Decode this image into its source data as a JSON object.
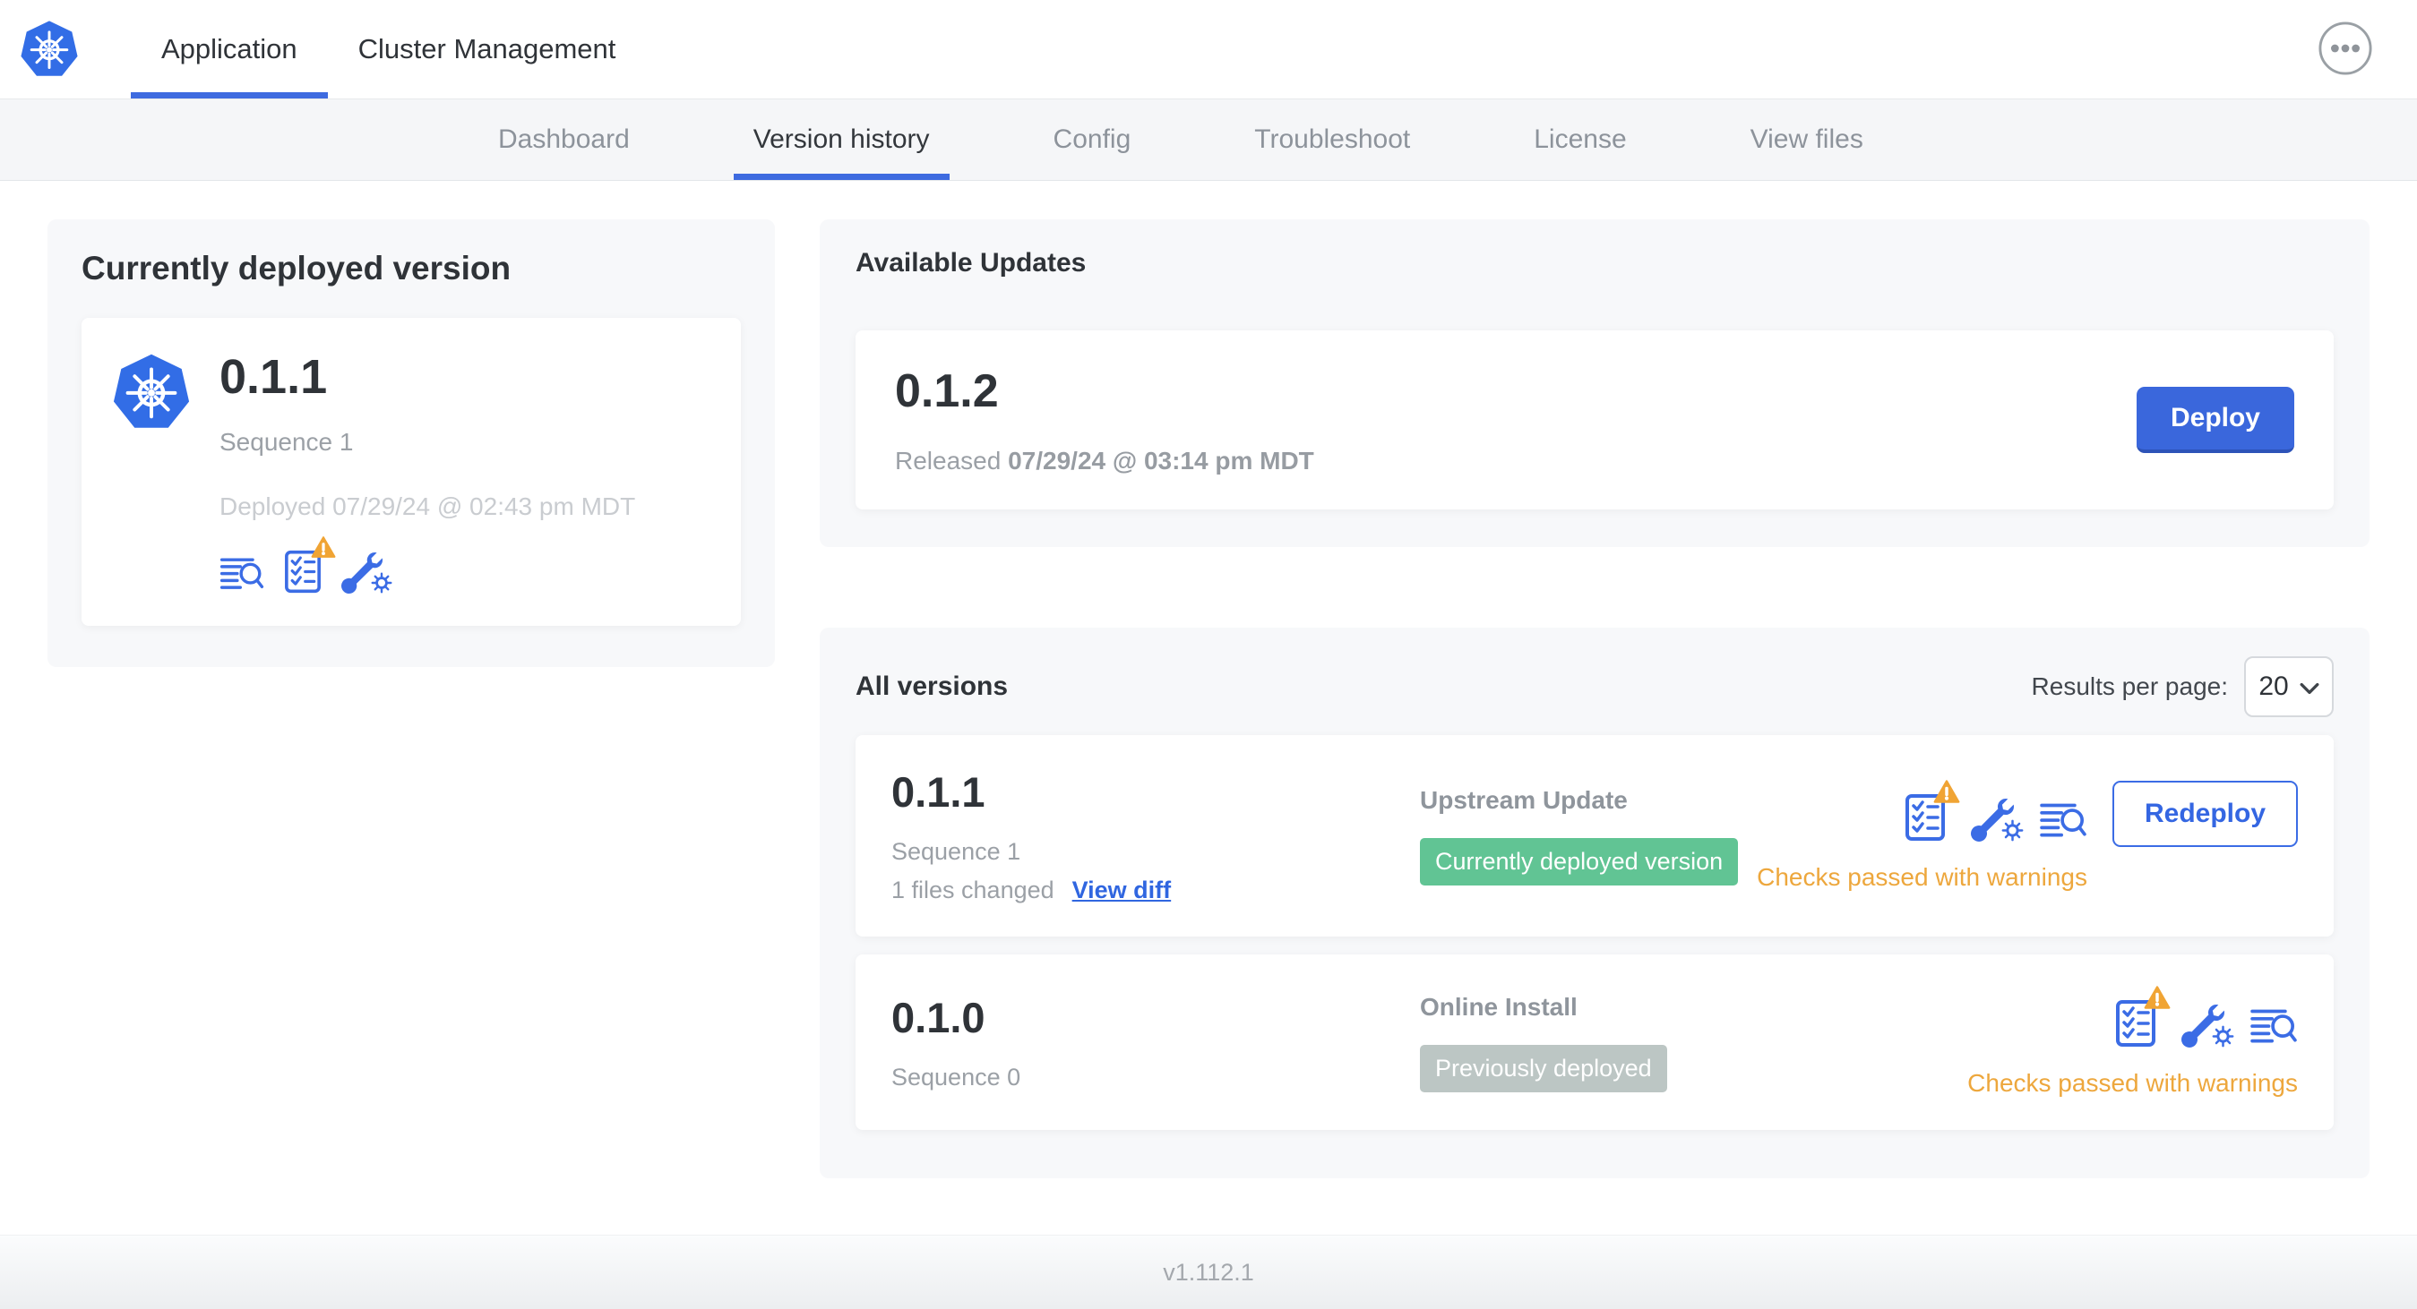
{
  "header": {
    "tabs": [
      {
        "label": "Application",
        "active": true
      },
      {
        "label": "Cluster Management",
        "active": false
      }
    ]
  },
  "subnav": {
    "tabs": [
      {
        "label": "Dashboard",
        "active": false
      },
      {
        "label": "Version history",
        "active": true
      },
      {
        "label": "Config",
        "active": false
      },
      {
        "label": "Troubleshoot",
        "active": false
      },
      {
        "label": "License",
        "active": false
      },
      {
        "label": "View files",
        "active": false
      }
    ]
  },
  "current_version": {
    "title": "Currently deployed version",
    "version": "0.1.1",
    "sequence": "Sequence 1",
    "deployed": "Deployed 07/29/24 @ 02:43 pm MDT"
  },
  "available_updates": {
    "title": "Available Updates",
    "version": "0.1.2",
    "released_prefix": "Released",
    "released_date": "07/29/24 @ 03:14 pm MDT",
    "deploy_label": "Deploy"
  },
  "all_versions": {
    "title": "All versions",
    "results_per_page_label": "Results per page:",
    "results_per_page_value": "20",
    "rows": [
      {
        "version": "0.1.1",
        "sequence": "Sequence 1",
        "files_changed": "1 files changed",
        "view_diff_label": "View diff",
        "source": "Upstream Update",
        "badge": "Currently deployed version",
        "badge_type": "green",
        "checks_status": "Checks passed with warnings",
        "action_label": "Redeploy"
      },
      {
        "version": "0.1.0",
        "sequence": "Sequence 0",
        "source": "Online Install",
        "badge": "Previously deployed",
        "badge_type": "gray",
        "checks_status": "Checks passed with warnings"
      }
    ]
  },
  "footer": {
    "version": "v1.112.1"
  },
  "icons": [
    "kubernetes-logo",
    "ellipsis",
    "file-search",
    "preflight-checklist",
    "warning-triangle",
    "config-wrench",
    "chevron-down"
  ],
  "colors": {
    "primary_blue": "#3b6ce5",
    "logo_blue": "#326de6",
    "green_badge": "#61c494",
    "gray_badge": "#bcc6c4",
    "warning_orange": "#eda73d"
  }
}
